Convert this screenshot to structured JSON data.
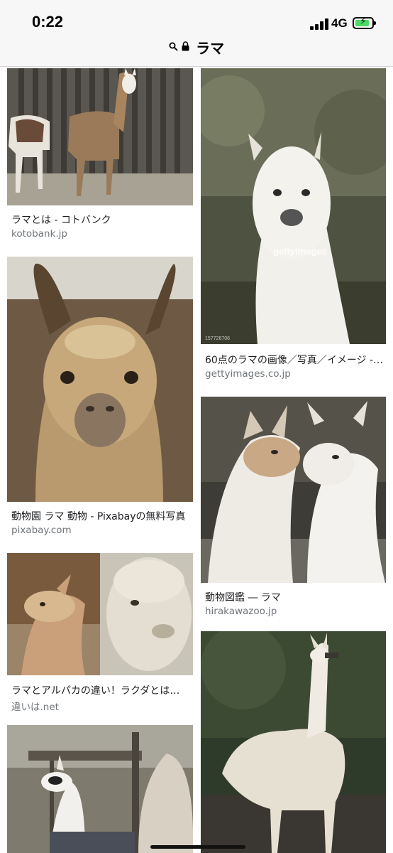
{
  "status_bar": {
    "time": "0:22",
    "network": "4G",
    "battery_level": 0.85
  },
  "url_bar": {
    "search_icon": "search-icon",
    "lock_icon": "lock-icon",
    "query": "ラマ"
  },
  "results": [
    {
      "caption": "ラマとは - コトバンク",
      "source": "kotobank.jp"
    },
    {
      "caption": "60点のラマの画像／写真／イメージ - ...",
      "source": "gettyimages.co.jp",
      "watermark": "gettyimages",
      "image_id": "157726706"
    },
    {
      "caption": "動物園 ラマ 動物 - Pixabayの無料写真",
      "source": "pixabay.com"
    },
    {
      "caption": "動物図鑑 ― ラマ",
      "source": "hirakawazoo.jp"
    },
    {
      "caption": "ラマとアルパカの違い！ラクダとは何...",
      "source": "違いは.net"
    },
    {
      "caption": "",
      "source": ""
    },
    {
      "caption": "",
      "source": ""
    }
  ],
  "colors": {
    "bar_bg": "#f7f7f7",
    "caption": "#202124",
    "source": "#70757a",
    "battery_green": "#4cd964"
  }
}
